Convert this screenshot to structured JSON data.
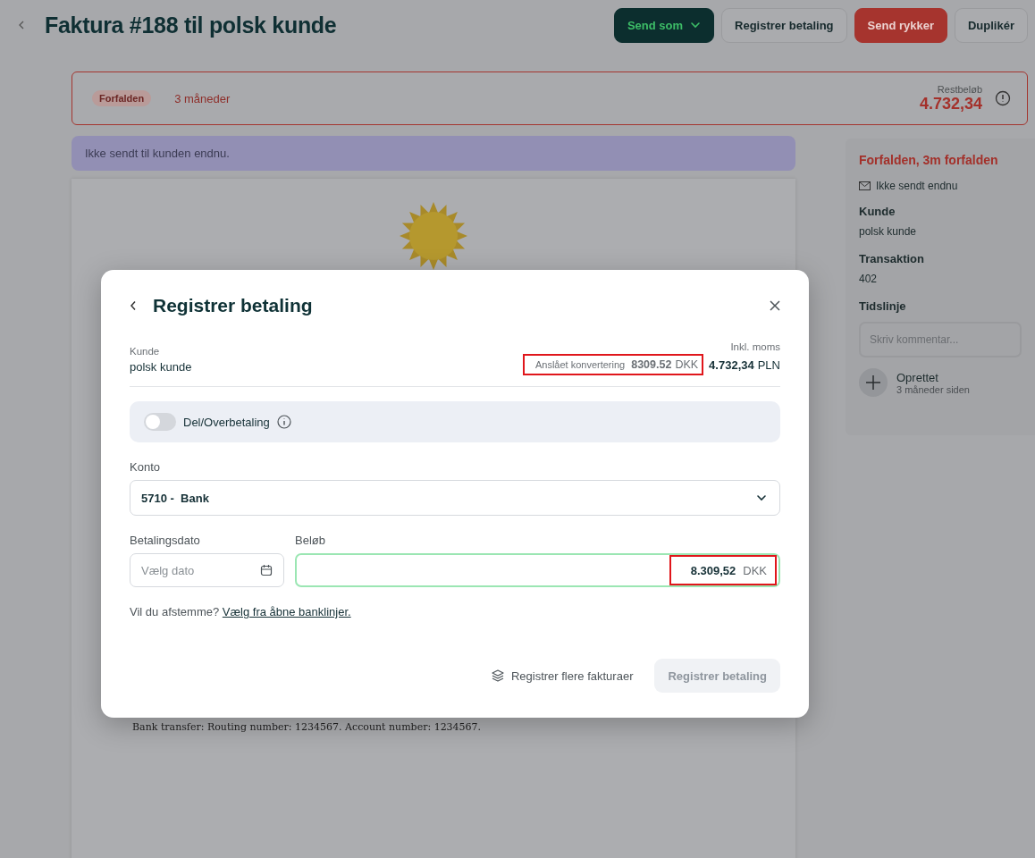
{
  "header": {
    "title": "Faktura #188 til polsk kunde",
    "buttons": [
      {
        "label": "Send som",
        "kind": "dropdown"
      },
      {
        "label": "Registrer betaling",
        "kind": "secondary"
      },
      {
        "label": "Send rykker",
        "kind": "danger"
      },
      {
        "label": "Duplikér",
        "kind": "secondary"
      }
    ]
  },
  "status": {
    "badge": "Forfalden",
    "age": "3 måneder",
    "remaining_label": "Restbeløb",
    "remaining": "4.732,34"
  },
  "notice": "Ikke sendt til kunden endnu.",
  "invoice": {
    "footer": "Bank transfer: Routing number: 1234567. Account number: 1234567."
  },
  "sidebar": {
    "status": "Forfalden, 3m forfalden",
    "sent": "Ikke sendt endnu",
    "sections": [
      {
        "heading": "Kunde",
        "value": "polsk kunde"
      },
      {
        "heading": "Transaktion",
        "value": "402"
      }
    ],
    "timeline_heading": "Tidslinje",
    "comment_placeholder": "Skriv kommentar...",
    "events": [
      {
        "title": "Oprettet",
        "time": "3 måneder siden"
      }
    ]
  },
  "modal": {
    "title": "Registrer betaling",
    "customer_label": "Kunde",
    "customer": "polsk kunde",
    "total_label": "Inkl. moms",
    "conversion": {
      "label": "Anslået konvertering",
      "amount": "8309.52",
      "currency": "DKK",
      "highlighted": true
    },
    "total": "4.732,34",
    "total_currency": "PLN",
    "partial": {
      "label": "Del/Overbetaling",
      "on": false
    },
    "account_label": "Konto",
    "account": "5710 -  Bank",
    "date_label": "Betalingsdato",
    "date_placeholder": "Vælg dato",
    "amount_label": "Beløb",
    "amount": {
      "value": "8.309,52",
      "currency": "DKK",
      "highlighted": true
    },
    "reconcile_text": "Vil du afstemme?",
    "reconcile_link": "Vælg fra åbne banklinjer.",
    "multi_button": "Registrer flere fakturaer",
    "submit": {
      "label": "Registrer betaling",
      "disabled": true
    }
  }
}
